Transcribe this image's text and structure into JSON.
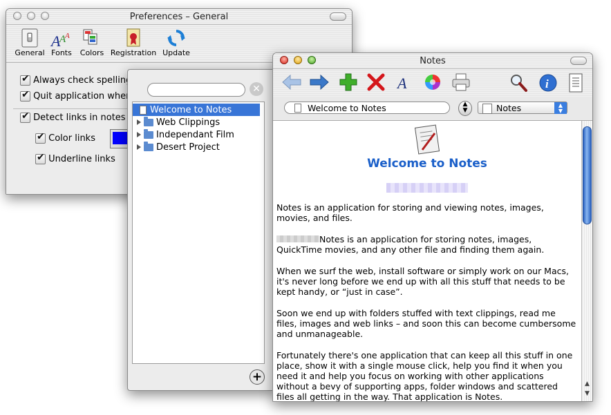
{
  "prefs": {
    "title": "Preferences – General",
    "toolbar": [
      {
        "label": "General",
        "icon": "general-icon"
      },
      {
        "label": "Fonts",
        "icon": "fonts-icon"
      },
      {
        "label": "Colors",
        "icon": "colors-icon"
      },
      {
        "label": "Registration",
        "icon": "registration-icon"
      },
      {
        "label": "Update",
        "icon": "update-icon"
      }
    ],
    "options": {
      "always_check": "Always check spelling",
      "quit_app": "Quit application when",
      "detect_links": "Detect links in notes a",
      "color_links": "Color links",
      "underline_links": "Underline links"
    },
    "link_color": "#0000ff"
  },
  "sidebar": {
    "search_placeholder": "",
    "items": [
      {
        "label": "Welcome to Notes",
        "type": "doc",
        "selected": true
      },
      {
        "label": "Web Clippings",
        "type": "folder"
      },
      {
        "label": "Independant Film",
        "type": "folder"
      },
      {
        "label": "Desert Project",
        "type": "folder"
      }
    ]
  },
  "notes": {
    "title": "Notes",
    "toolbar_icons": [
      "back-arrow-icon",
      "forward-arrow-icon",
      "add-icon",
      "delete-icon",
      "font-icon",
      "color-wheel-icon",
      "print-icon",
      "search-icon",
      "info-icon",
      "notes-list-icon"
    ],
    "path_field": "Welcome to Notes",
    "location_popup": "Notes",
    "doc_heading": "Welcome to Notes",
    "paragraphs": [
      "Notes is an application for storing and viewing notes, images, movies, and files.",
      "Notes is an application for storing notes, images, QuickTime movies, and any other file and finding them again.",
      "When we surf the web, install software or simply work on our Macs, it's never long before we end up with all this stuff that needs to be kept handy, or “just in case”.",
      "Soon we end up with folders stuffed with text clippings, read me files, images and web links – and soon this can become cumbersome and unmanageable.",
      "Fortunately there's one application that can keep all this stuff in one place, show it with a single mouse click, help you find it when you need it and help you focus on working with other applications without a bevy of supporting apps, folder windows and scattered files all getting in the way. That application is Notes."
    ],
    "accent_color": "#1a5fc9"
  }
}
